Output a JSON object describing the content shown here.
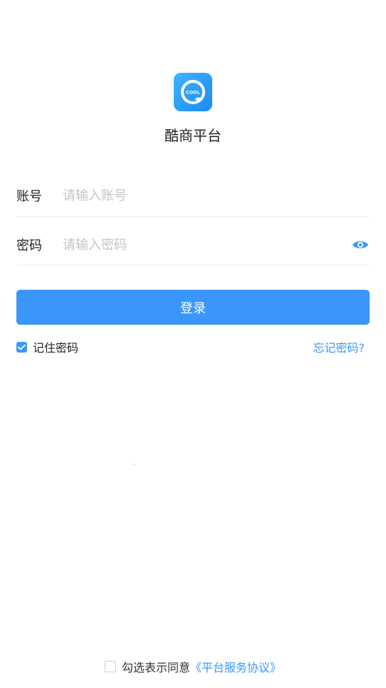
{
  "app": {
    "logo_text": "COOL",
    "name": "酷商平台"
  },
  "account": {
    "label": "账号",
    "placeholder": "请输入账号",
    "value": ""
  },
  "password": {
    "label": "密码",
    "placeholder": "请输入密码",
    "value": "",
    "toggle_icon": "eye-icon"
  },
  "login": {
    "button_label": "登录"
  },
  "remember": {
    "label": "记住密码",
    "checked": true
  },
  "forgot": {
    "label": "忘记密码?"
  },
  "agreement": {
    "prefix": "勾选表示同意",
    "link": "《平台服务协议》",
    "checked": false
  },
  "colors": {
    "accent": "#3a97f9",
    "logo_gradient_start": "#3fb3ff",
    "logo_gradient_end": "#1a8cf0",
    "placeholder": "#c4c4c4",
    "divider": "#ececec"
  }
}
